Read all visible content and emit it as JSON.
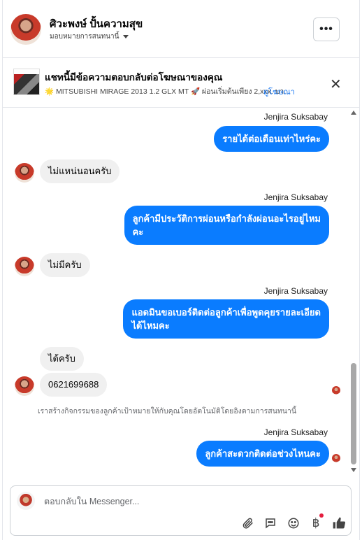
{
  "header": {
    "contact_name": "ศิวะพงษ์ ปั้นความสุข",
    "assign_label": "มอบหมายการสนทนานี้",
    "more_label": "•••"
  },
  "ad": {
    "title": "แชทนี้มีข้อความตอบกลับต่อโฆษณาของคุณ",
    "subtitle": "🌟 MITSUBISHI MIRAGE 2013 1.2 GLX MT 🚀 ผ่อนเริ่มต้นเพียง 2,xxx. บา...",
    "link": "ดูโฆษณา",
    "close_icon": "close-icon"
  },
  "messages": [
    {
      "sender": "Jenjira Suksabay",
      "text": "รายได้ต่อเดือนเท่าไหร่คะ"
    },
    {
      "text": "ไม่แหน่นอนครับ"
    },
    {
      "sender": "Jenjira Suksabay",
      "text_line1": "ลูกค้ามีประวัติการผ่อนหรือกำลังผ่อนอะไรอยู่ไหม",
      "text_line2": "คะ"
    },
    {
      "text": "ไม่มีครับ"
    },
    {
      "sender": "Jenjira Suksabay",
      "text_line1": "แอดมินขอเบอร์ติดต่อลูกค้าเพื่อพูดคุยรายละเอียด",
      "text_line2": "ได้ไหมคะ"
    },
    {
      "text": "ได้ครับ"
    },
    {
      "text": "0621699688"
    },
    {
      "system": "เราสร้างกิจกรรมของลูกค้าเป้าหมายให้กับคุณโดยอัตโนมัติโดยอิงตามการสนทนานี้"
    },
    {
      "sender": "Jenjira Suksabay",
      "text": "ลูกค้าสะดวกติดต่อช่วงไหนคะ"
    }
  ],
  "composer": {
    "placeholder": "ตอบกลับใน Messenger...",
    "tools": [
      "attach-icon",
      "chat-bubble-icon",
      "emoji-icon",
      "baht-icon",
      "thumbs-up-icon"
    ],
    "baht_glyph": "฿"
  },
  "colors": {
    "accent": "#0a7cff",
    "incoming": "#f0f0f0",
    "link": "#1877f2"
  }
}
